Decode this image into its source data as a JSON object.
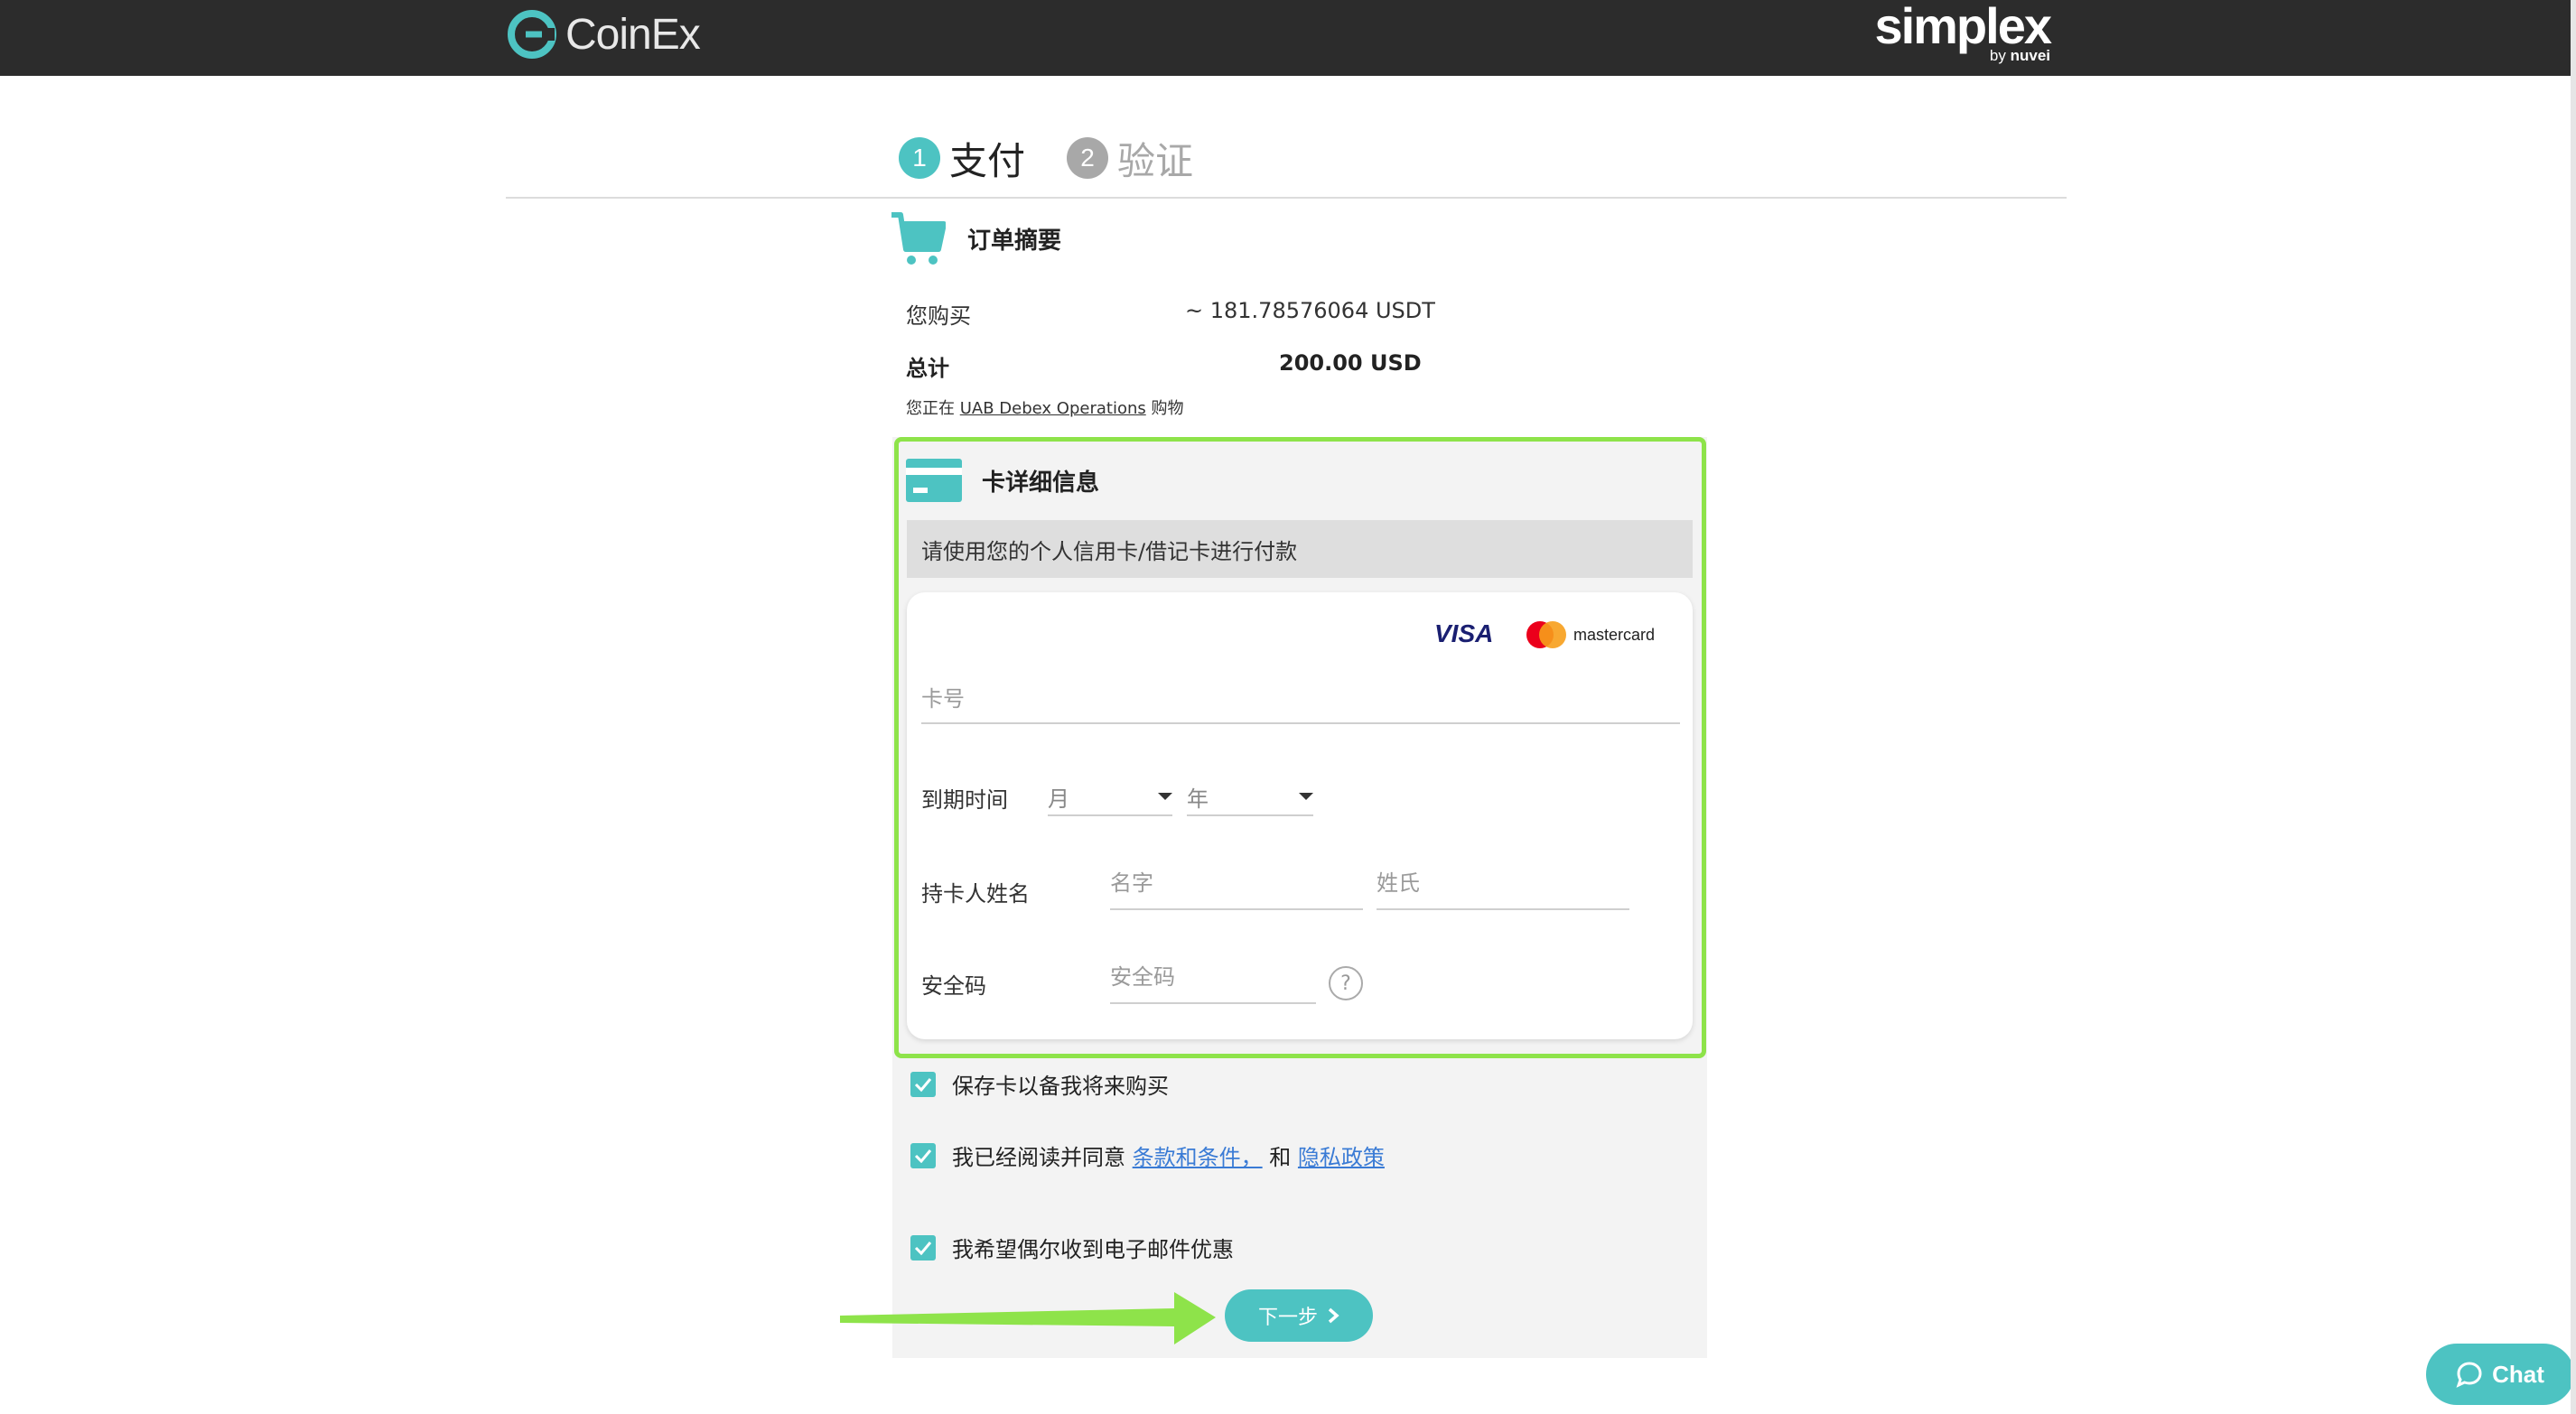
{
  "header": {
    "brand_left": "CoinEx",
    "brand_right": "simplex",
    "brand_right_by": "by",
    "brand_right_by_name": "nuvei"
  },
  "steps": [
    {
      "num": "1",
      "label": "支付",
      "state": "active"
    },
    {
      "num": "2",
      "label": "验证",
      "state": "inactive"
    }
  ],
  "summary": {
    "title": "订单摘要",
    "buy_label": "您购买",
    "buy_value": "~ 181.78576064 USDT",
    "total_label": "总计",
    "total_value": "200.00 USD",
    "merchant_prefix": "您正在",
    "merchant_name": "UAB Debex Operations",
    "merchant_suffix": "购物"
  },
  "card": {
    "title": "卡详细信息",
    "notice": "请使用您的个人信用卡/借记卡进行付款",
    "visa": "VISA",
    "mastercard": "mastercard",
    "card_number_placeholder": "卡号",
    "expiry_label": "到期时间",
    "month_placeholder": "月",
    "year_placeholder": "年",
    "holder_label": "持卡人姓名",
    "first_name_placeholder": "名字",
    "last_name_placeholder": "姓氏",
    "cvv_label": "安全码",
    "cvv_placeholder": "安全码",
    "help": "?"
  },
  "checks": {
    "save_card": "保存卡以备我将来购买",
    "agree_prefix": "我已经阅读并同意",
    "terms_link": "条款和条件，",
    "agree_and": "和",
    "privacy_link": "隐私政策",
    "marketing": "我希望偶尔收到电子邮件优惠"
  },
  "next_button": "下一步",
  "chat_button": "Chat",
  "colors": {
    "accent": "#4dc3c2",
    "highlight": "#8ee34a",
    "topbar": "#2c2c2c"
  }
}
